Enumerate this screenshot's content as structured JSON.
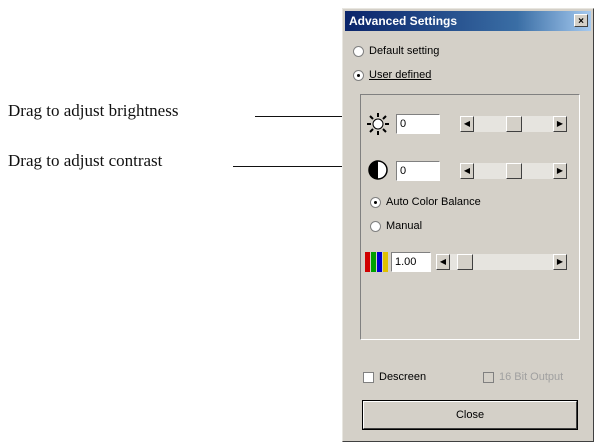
{
  "callouts": {
    "brightness": "Drag to adjust brightness",
    "contrast": "Drag to adjust contrast"
  },
  "dialog": {
    "title": "Advanced Settings",
    "close_glyph": "×",
    "mode": {
      "default_label": "Default setting",
      "user_label": "User defined",
      "selected": "User defined"
    },
    "brightness": {
      "value": "0",
      "slider_level": 0.5
    },
    "contrast": {
      "value": "0",
      "slider_level": 0.5
    },
    "color": {
      "auto_label": "Auto Color Balance",
      "manual_label": "Manual",
      "selected": "Auto Color Balance",
      "gamma_value": "1.00",
      "slider_level": 0.08
    },
    "descreen_label": "Descreen",
    "disabled_option_label": "16 Bit Output",
    "close_button": "Close"
  },
  "icons": {
    "brightness": "sun-icon",
    "contrast": "half-circle-icon",
    "color": "rgb-bars-icon"
  }
}
